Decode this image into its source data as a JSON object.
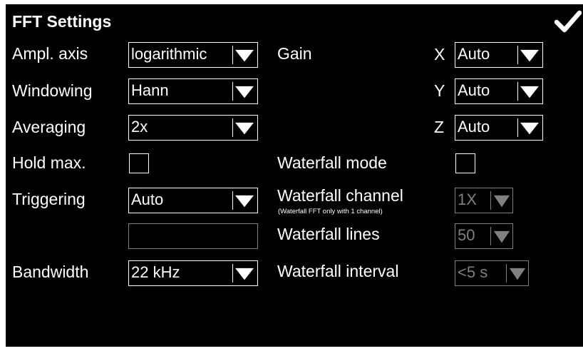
{
  "title": "FFT Settings",
  "confirm_icon": "checkmark-icon",
  "labels": {
    "ampl_axis": "Ampl. axis",
    "windowing": "Windowing",
    "averaging": "Averaging",
    "hold_max": "Hold max.",
    "triggering": "Triggering",
    "bandwidth": "Bandwidth",
    "gain": "Gain",
    "gain_x": "X",
    "gain_y": "Y",
    "gain_z": "Z",
    "waterfall_mode": "Waterfall mode",
    "waterfall_channel": "Waterfall channel",
    "waterfall_channel_note": "(Waterfall FFT only with 1 channel)",
    "waterfall_lines": "Waterfall lines",
    "waterfall_interval": "Waterfall interval"
  },
  "values": {
    "ampl_axis": "logarithmic",
    "windowing": "Hann",
    "averaging": "2x",
    "triggering": "Auto",
    "trigger_level": "",
    "bandwidth": "22 kHz",
    "gain_x": "Auto",
    "gain_y": "Auto",
    "gain_z": "Auto",
    "waterfall_channel": "1X",
    "waterfall_lines": "50",
    "waterfall_interval": "<5 s"
  },
  "checkboxes": {
    "hold_max": false,
    "waterfall_mode": false
  },
  "colors": {
    "background": "#000000",
    "foreground": "#ffffff",
    "disabled": "#808080"
  }
}
